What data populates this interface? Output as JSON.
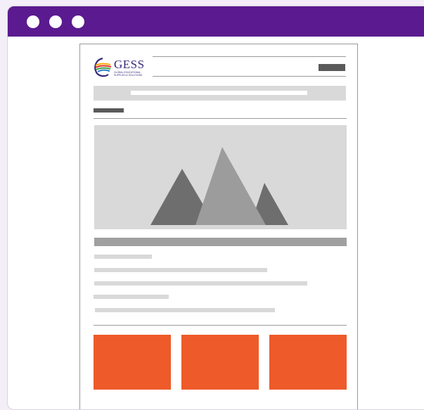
{
  "logo": {
    "wordmark": "GESS",
    "tagline_line1": "GLOBAL EDUCATIONAL",
    "tagline_line2": "SUPPLIES & SOLUTIONS"
  },
  "colors": {
    "titlebar": "#5b1a8f",
    "card_accent": "#ee5a2a",
    "placeholder_gray": "#d9d9d9",
    "dark_stub": "#5a5a5a"
  },
  "window": {
    "controls": [
      "window-dot",
      "window-dot",
      "window-dot"
    ]
  },
  "hero": {
    "icon": "mountains-placeholder-icon"
  },
  "cards": [
    {
      "name": "card-1"
    },
    {
      "name": "card-2"
    },
    {
      "name": "card-3"
    }
  ]
}
